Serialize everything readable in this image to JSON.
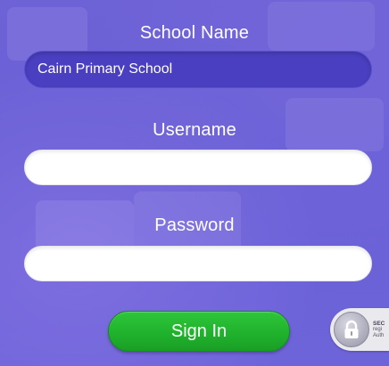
{
  "form": {
    "school_label": "School Name",
    "school_value": "Cairn Primary School",
    "username_label": "Username",
    "username_value": "",
    "password_label": "Password",
    "password_value": "",
    "signin_label": "Sign In"
  },
  "badge": {
    "line1": "SEC",
    "line2": "regi",
    "line3": "Auth",
    "icon": "lock-icon"
  },
  "colors": {
    "background": "#6a5fd3",
    "school_field": "#4a3fc0",
    "signin_button": "#22b02e",
    "label_text": "#ffffff"
  }
}
